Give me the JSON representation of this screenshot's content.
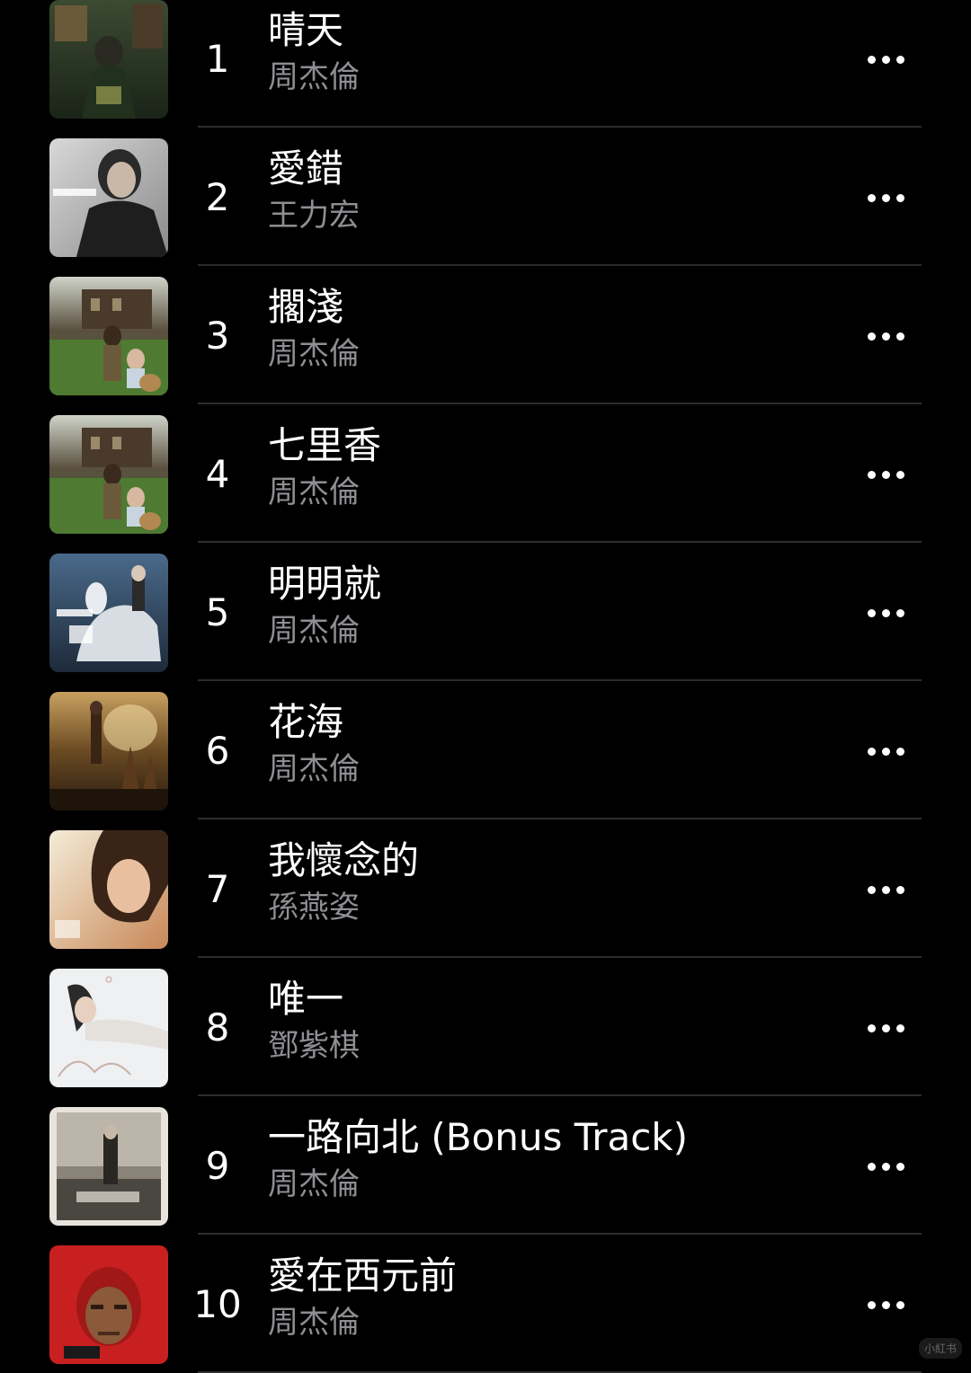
{
  "tracks": [
    {
      "rank": "1",
      "title": "晴天",
      "artist": "周杰倫",
      "art": "dark-green"
    },
    {
      "rank": "2",
      "title": "愛錯",
      "artist": "王力宏",
      "art": "gray-portrait"
    },
    {
      "rank": "3",
      "title": "擱淺",
      "artist": "周杰倫",
      "art": "garden"
    },
    {
      "rank": "4",
      "title": "七里香",
      "artist": "周杰倫",
      "art": "garden"
    },
    {
      "rank": "5",
      "title": "明明就",
      "artist": "周杰倫",
      "art": "blue-horse"
    },
    {
      "rank": "6",
      "title": "花海",
      "artist": "周杰倫",
      "art": "brown-fantasy"
    },
    {
      "rank": "7",
      "title": "我懷念的",
      "artist": "孫燕姿",
      "art": "warm-portrait"
    },
    {
      "rank": "8",
      "title": "唯一",
      "artist": "鄧紫棋",
      "art": "white-portrait"
    },
    {
      "rank": "9",
      "title": "一路向北 (Bonus Track)",
      "artist": "周杰倫",
      "art": "framed-sepia"
    },
    {
      "rank": "10",
      "title": "愛在西元前",
      "artist": "周杰倫",
      "art": "red-hood"
    }
  ],
  "watermark": "小紅书",
  "colors": {
    "background": "#000000",
    "primary_text": "#ffffff",
    "secondary_text": "#8e8e93",
    "separator": "#2c2c2e"
  },
  "icons": {
    "more": "more-horizontal-icon"
  }
}
